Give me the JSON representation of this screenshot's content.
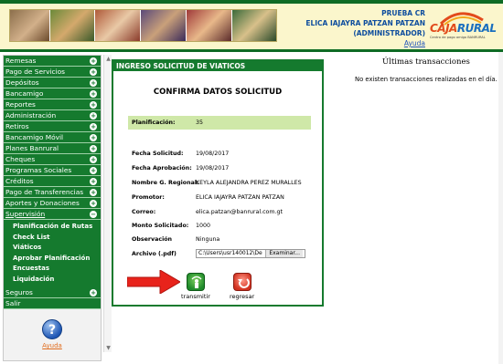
{
  "header": {
    "env_label": "PRUEBA CR",
    "user_name": "ELICA IAJAYRA PATZAN PATZAN",
    "role": "(ADMINISTRADOR)",
    "help_link": "Ayuda",
    "logo_main": "CAJA",
    "logo_accent": "RURAL",
    "logo_tagline": "Centro de pago amigo BANRURAL"
  },
  "sidebar": {
    "items": [
      {
        "label": "Remesas"
      },
      {
        "label": "Pago de Servicios"
      },
      {
        "label": "Depósitos"
      },
      {
        "label": "Bancamigo"
      },
      {
        "label": "Reportes"
      },
      {
        "label": "Administración"
      },
      {
        "label": "Retiros"
      },
      {
        "label": "Bancamigo Móvil"
      },
      {
        "label": "Planes Banrural"
      },
      {
        "label": "Cheques"
      },
      {
        "label": "Programas Sociales"
      },
      {
        "label": "Créditos"
      },
      {
        "label": "Pago de Transferencias"
      },
      {
        "label": "Aportes y Donaciones"
      },
      {
        "label": "Supervisión"
      }
    ],
    "submenu": [
      {
        "label": "Planificación de Rutas"
      },
      {
        "label": "Check List"
      },
      {
        "label": "Viáticos"
      },
      {
        "label": "Aprobar Planificación"
      },
      {
        "label": "Encuestas"
      },
      {
        "label": "Liquidación"
      }
    ],
    "after_items": [
      {
        "label": "Seguros"
      },
      {
        "label": "Salir"
      }
    ],
    "help_label": "Ayuda"
  },
  "form": {
    "panel_title": "INGRESO SOLICITUD DE VIATICOS",
    "heading": "CONFIRMA DATOS SOLICITUD",
    "planificacion_label": "Planificación:",
    "planificacion_value": "35",
    "fecha_solicitud_label": "Fecha Solicitud:",
    "fecha_solicitud_value": "19/08/2017",
    "fecha_aprobacion_label": "Fecha Aprobación:",
    "fecha_aprobacion_value": "19/08/2017",
    "nombre_regional_label": "Nombre G. Regional:",
    "nombre_regional_value": "KEYLA ALEJANDRA PEREZ MURALLES",
    "promotor_label": "Promotor:",
    "promotor_value": "ELICA IAJAYRA PATZAN PATZAN",
    "correo_label": "Correo:",
    "correo_value": "elica.patzan@banrural.com.gt",
    "monto_label": "Monto Solicitado:",
    "monto_value": "1000",
    "observacion_label": "Observación",
    "observacion_value": "Ninguna",
    "archivo_label": "Archivo (.pdf)",
    "archivo_value": "C:\\Users\\usr140012\\De",
    "browse_label": "Examinar...",
    "transmit_label": "transmitir",
    "back_label": "regresar"
  },
  "recent": {
    "title": "Últimas transacciones",
    "empty_message": "No existen transacciones realizadas en el día."
  },
  "colors": {
    "brand_green": "#157a2e",
    "highlight_row": "#cfe8a8",
    "header_bg": "#fbf6cc"
  }
}
